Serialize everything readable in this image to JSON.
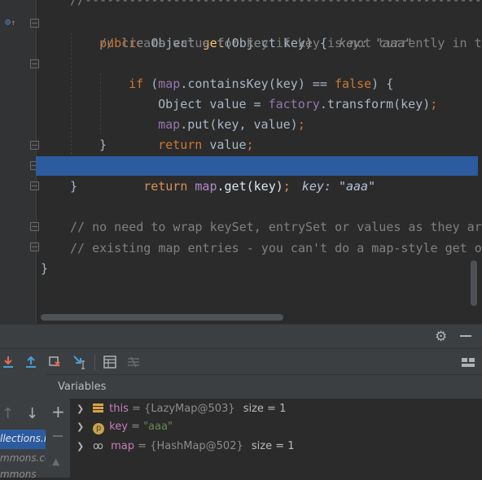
{
  "editor": {
    "top_comment": "//--------------------------------------------------------------------",
    "lines": {
      "sig_kw": "public",
      "sig_type": " Object ",
      "sig_method": "get",
      "sig_params": "(Object key) {",
      "sig_hint": "key: \"aaa\"",
      "comment1": "// create value for key if key is not currently in t",
      "if_kw": "if",
      "if_open": " (",
      "if_map": "map",
      "if_rest": ".containsKey(key) == ",
      "if_false": "false",
      "if_close": ") {",
      "obj_decl": "Object value = ",
      "obj_factory": "factory",
      "obj_rest": ".transform(key)",
      "obj_semi": ";",
      "put_map": "map",
      "put_rest": ".put(key, value)",
      "put_semi": ";",
      "ret_kw": "return",
      "ret_rest": " value",
      "ret_semi": ";",
      "close_if": "}",
      "exec_kw": "return",
      "exec_sp": " ",
      "exec_map": "map",
      "exec_rest": ".get(key)",
      "exec_semi": ";",
      "exec_hint": "key: \"aaa\"",
      "close_method": "}",
      "comment2": "// no need to wrap keySet, entrySet or values as they ar",
      "comment3": "// existing map entries - you can't do a map-style get o",
      "close_class": "}"
    }
  },
  "debug": {
    "variables_title": "Variables",
    "frames": [
      "llections.i",
      "mmons.co",
      "mmons"
    ],
    "variables": [
      {
        "name": "this",
        "eq": " = ",
        "value": "{LazyMap@503}",
        "extra": "size = 1",
        "icon": "fields-icon"
      },
      {
        "name": "key",
        "eq": " = ",
        "value": "\"aaa\"",
        "extra": "",
        "icon": "param-icon",
        "badge": "p"
      },
      {
        "name": "map",
        "eq": " = ",
        "value": "{HashMap@502}",
        "extra": "size = 1",
        "icon": "watch-glasses-icon"
      }
    ]
  },
  "colors": {
    "accent": "#2d5b9f",
    "keyword": "#cc7832",
    "method": "#ffc66d",
    "field": "#9876aa",
    "string": "#6a8759"
  }
}
